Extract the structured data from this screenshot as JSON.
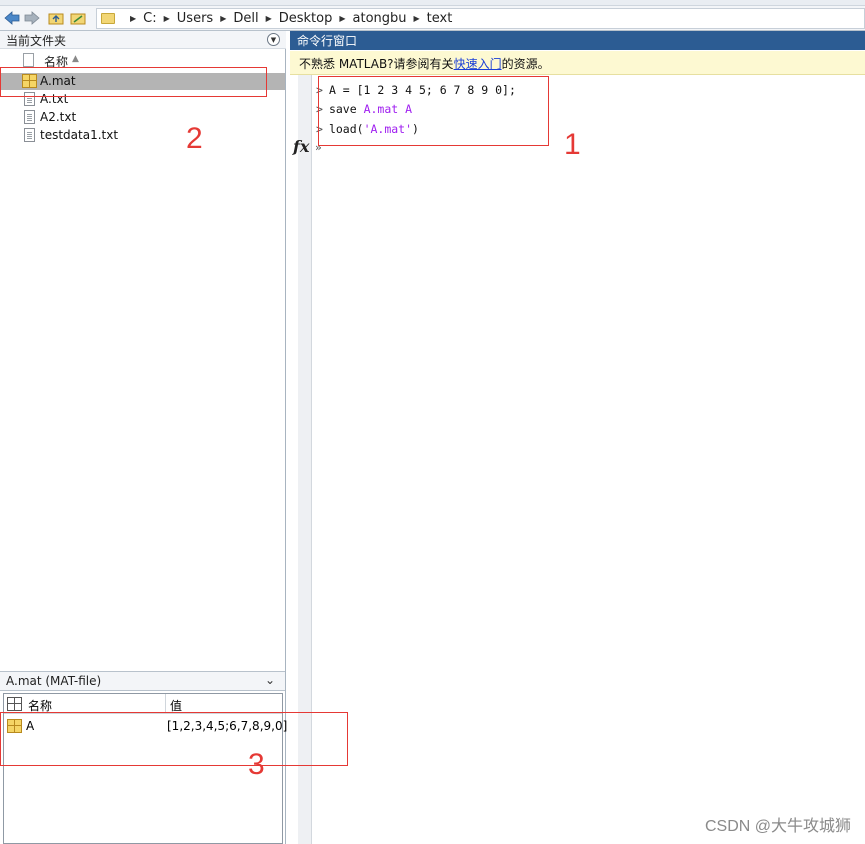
{
  "toolbar": {
    "breadcrumbs": [
      "C:",
      "Users",
      "Dell",
      "Desktop",
      "atongbu",
      "text"
    ]
  },
  "current_folder": {
    "title": "当前文件夹",
    "column_name": "名称",
    "files": [
      {
        "name": "A.mat",
        "icon": "mat-file-icon",
        "selected": true
      },
      {
        "name": "A.txt",
        "icon": "text-file-icon",
        "selected": false
      },
      {
        "name": "A2.txt",
        "icon": "text-file-icon",
        "selected": false
      },
      {
        "name": "testdata1.txt",
        "icon": "text-file-icon",
        "selected": false
      }
    ]
  },
  "details": {
    "title": "A.mat  (MAT-file)",
    "col_name": "名称",
    "col_value": "值",
    "rows": [
      {
        "name": "A",
        "value": "[1,2,3,4,5;6,7,8,9,0]"
      }
    ]
  },
  "command_window": {
    "title": "命令行窗口",
    "notice_prefix": "不熟悉 MATLAB?请参阅有关",
    "notice_link": "快速入门",
    "notice_suffix": "的资源。",
    "lines": [
      {
        "cmd": "A = [1 2 3 4 5; 6 7 8 9 0];",
        "arg": ""
      },
      {
        "cmd": "save ",
        "arg": "A.mat A"
      },
      {
        "cmd": "load(",
        "arg": "'A.mat'",
        "tail": ")"
      }
    ],
    "fx_label": "fx"
  },
  "annotations": {
    "n1": "1",
    "n2": "2",
    "n3": "3",
    "color": "#e53935"
  },
  "watermark": "CSDN @大牛攻城狮"
}
